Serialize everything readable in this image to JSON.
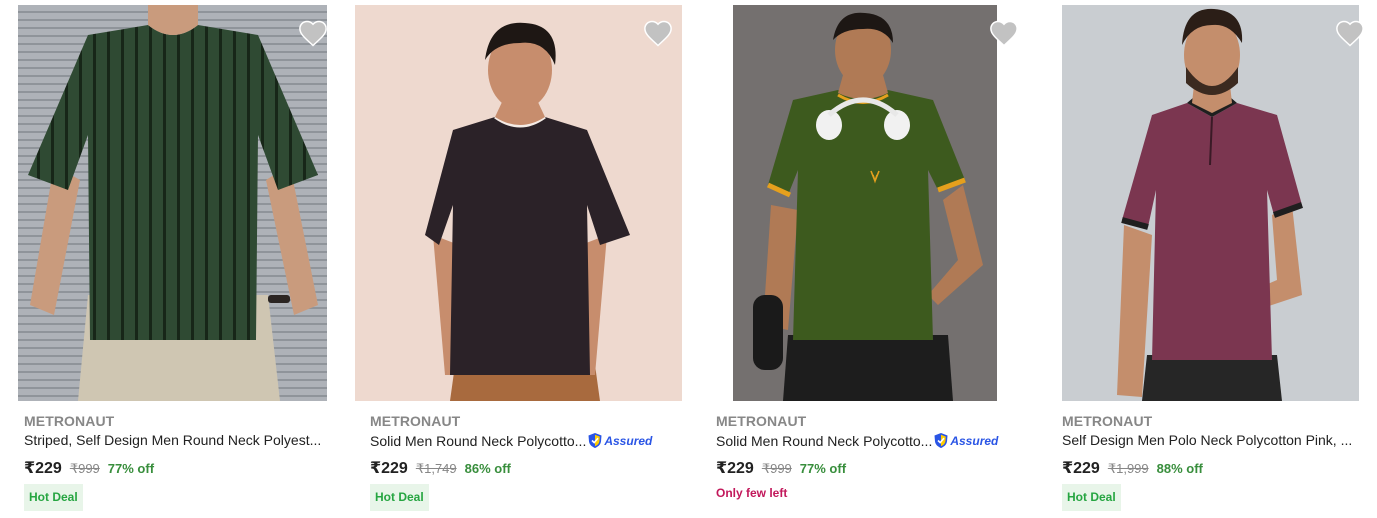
{
  "products": [
    {
      "brand": "METRONAUT",
      "title": "Striped, Self Design Men Round Neck Polyest...",
      "price": "₹229",
      "mrp": "₹999",
      "discount": "77% off",
      "assured": false,
      "tag": "Hot Deal",
      "tag_type": "deal",
      "shirt_color": "#2f4a33",
      "bg_color": "#a4a8ae"
    },
    {
      "brand": "METRONAUT",
      "title": "Solid Men Round Neck Polycotto...",
      "price": "₹229",
      "mrp": "₹1,749",
      "discount": "86% off",
      "assured": true,
      "assured_label": "Assured",
      "tag": "Hot Deal",
      "tag_type": "deal",
      "shirt_color": "#2b2228",
      "bg_color": "#eed9cf"
    },
    {
      "brand": "METRONAUT",
      "title": "Solid Men Round Neck Polycotto...",
      "price": "₹229",
      "mrp": "₹999",
      "discount": "77% off",
      "assured": true,
      "assured_label": "Assured",
      "tag": "Only few left",
      "tag_type": "stock",
      "shirt_color": "#3d5a1e",
      "bg_color": "#6e6c6a"
    },
    {
      "brand": "METRONAUT",
      "title": "Self Design Men Polo Neck Polycotton Pink, ...",
      "price": "₹229",
      "mrp": "₹1,999",
      "discount": "88% off",
      "assured": false,
      "tag": "Hot Deal",
      "tag_type": "deal",
      "shirt_color": "#7b3650",
      "bg_color": "#c9cdd1"
    }
  ],
  "icons": {
    "wishlist": "heart-icon",
    "assured": "shield-check-icon"
  },
  "colors": {
    "brand_text": "#878787",
    "discount": "#388e3c",
    "hot_deal_bg": "#e8f5e9",
    "hot_deal_text": "#26a541",
    "stock_text": "#c2185b",
    "assured_blue": "#2a55e5"
  }
}
